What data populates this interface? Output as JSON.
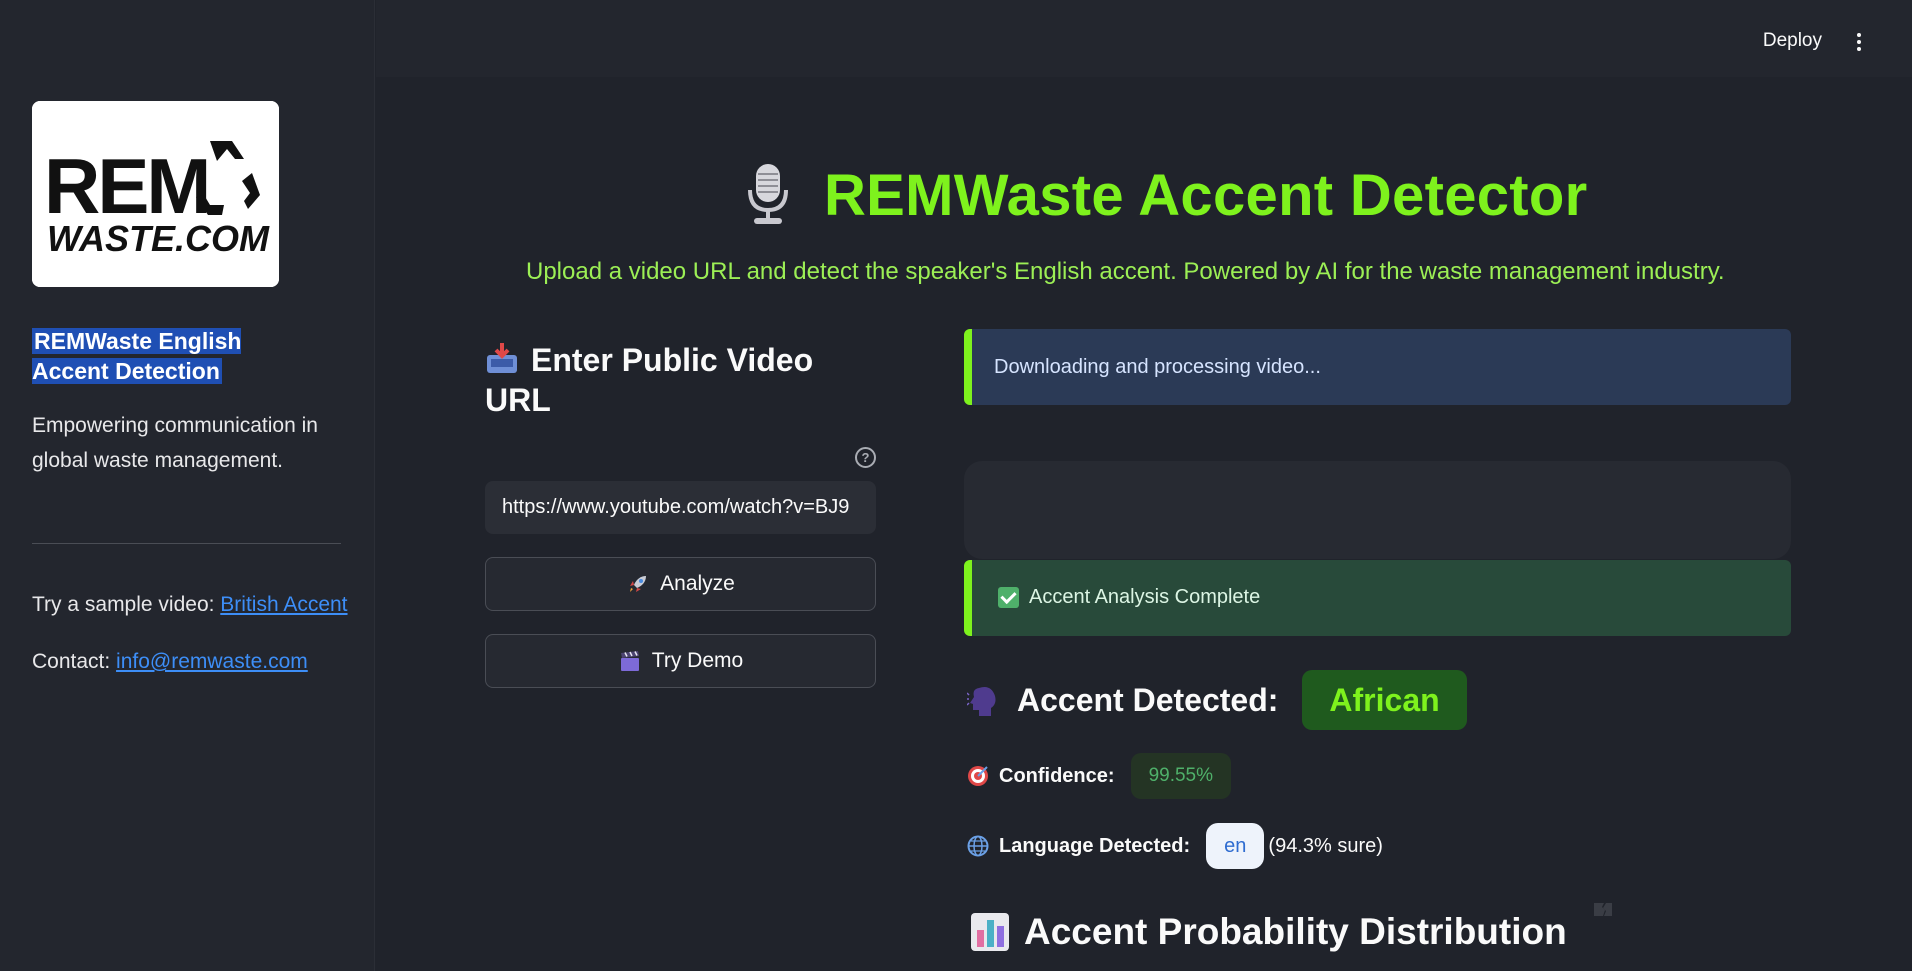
{
  "sidebar": {
    "logo_text_line1": "REM",
    "logo_text_line2": "WASTE.COM",
    "title": "REMWaste English Accent Detection",
    "description": "Empowering communication in global waste management.",
    "sample_prefix": "Try a sample video: ",
    "sample_link": "British Accent",
    "contact_prefix": "Contact: ",
    "contact_link": "info@remwaste.com"
  },
  "header": {
    "deploy_label": "Deploy"
  },
  "hero": {
    "title": "REMWaste Accent Detector",
    "subtitle": "Upload a video URL and detect the speaker's English accent. Powered by AI for the waste management industry."
  },
  "input_panel": {
    "title": "Enter Public Video URL",
    "url_value": "https://www.youtube.com/watch?v=BJ9",
    "analyze_label": "Analyze",
    "demo_label": "Try Demo"
  },
  "results": {
    "status_info": "Downloading and processing video...",
    "status_success": "Accent Analysis Complete",
    "accent_label": "Accent Detected:",
    "accent_value": "African",
    "confidence_label": "Confidence:",
    "confidence_value": "99.55%",
    "language_label": "Language Detected:",
    "language_value": "en",
    "language_sure": "(94.3% sure)",
    "distribution_title": "Accent Probability Distribution"
  },
  "colors": {
    "accent_green": "#7ef21d",
    "sidebar_bg": "#23262e",
    "main_bg": "#20232b",
    "info_bg": "#2b3a56",
    "success_bg": "#284a3a",
    "link_blue": "#3d8ef7"
  },
  "icons": {
    "hero": "microphone-icon",
    "input_title": "inbox-tray-icon",
    "analyze": "rocket-icon",
    "demo": "clapper-board-icon",
    "accent": "speaking-head-icon",
    "confidence": "target-icon",
    "language": "globe-icon",
    "distribution": "bar-chart-icon",
    "success": "check-mark-icon",
    "help": "question-circle-icon",
    "menu": "kebab-menu-icon"
  }
}
